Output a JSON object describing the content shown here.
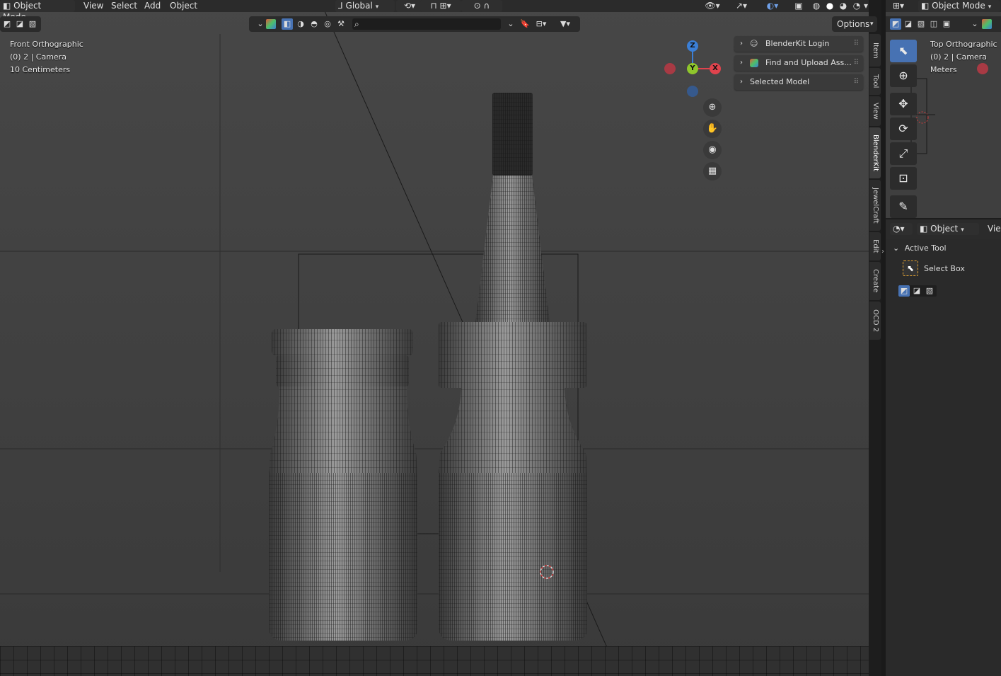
{
  "header": {
    "mode": "Object Mode",
    "menus": [
      "View",
      "Select",
      "Add",
      "Object"
    ],
    "transform_orientation": "Global",
    "options": "Options"
  },
  "viewport": {
    "view_name": "Front Orthographic",
    "collection": "(0) 2 | Camera",
    "scale": "10 Centimeters",
    "gizmo": {
      "z": "Z",
      "y": "Y",
      "x": "X"
    }
  },
  "npanel": {
    "items": [
      {
        "label": "BlenderKit Login"
      },
      {
        "label": "Find and Upload Ass..."
      },
      {
        "label": "Selected Model"
      }
    ],
    "tabs": [
      "Item",
      "Tool",
      "View",
      "BlenderKit",
      "JewelCraft",
      "Edit",
      "Create",
      "OCD 2"
    ],
    "active_tab": "BlenderKit"
  },
  "right_view": {
    "mode": "Object Mode",
    "view_name": "Top Orthographic",
    "collection": "(0) 2 | Camera",
    "scale": "Meters"
  },
  "properties": {
    "context": "Object",
    "view_menu": "View",
    "section": "Active Tool",
    "tool_name": "Select Box"
  },
  "colors": {
    "accent": "#4772b3",
    "axis_x": "#e0434d",
    "axis_y": "#8fc62c",
    "axis_z": "#3b7fd6"
  }
}
